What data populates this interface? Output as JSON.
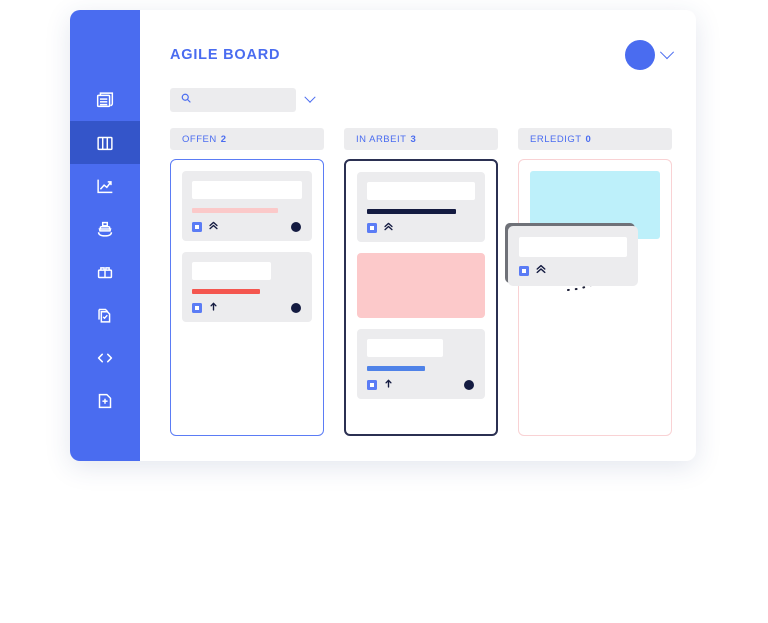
{
  "app": {
    "title": "AGILE BOARD"
  },
  "sidebar": {
    "items": [
      {
        "id": "reports",
        "icon": "stacked-document-icon",
        "active": false
      },
      {
        "id": "board",
        "icon": "columns-board-icon",
        "active": true
      },
      {
        "id": "analytics",
        "icon": "line-chart-icon",
        "active": false
      },
      {
        "id": "shipping",
        "icon": "ship-icon",
        "active": false
      },
      {
        "id": "toolbox",
        "icon": "toolbox-icon",
        "active": false
      },
      {
        "id": "tasks",
        "icon": "checked-pages-icon",
        "active": false
      },
      {
        "id": "code",
        "icon": "code-brackets-icon",
        "active": false
      },
      {
        "id": "new-file",
        "icon": "add-file-icon",
        "active": false
      }
    ]
  },
  "search": {
    "value": "",
    "placeholder": "",
    "icon": "search-icon",
    "dropdown_icon": "chevron-down-icon"
  },
  "profile": {
    "avatar": "user-avatar",
    "dropdown_icon": "chevron-down-icon"
  },
  "colors": {
    "brand_blue": "#4a6cf0",
    "sidebar_active": "#3455c9",
    "card_bg": "#ececee",
    "bar_pale_pink": "#fbc9c9",
    "bar_red": "#f4564f",
    "bar_navy": "#141b41",
    "bar_blue": "#4f82e8",
    "dropzone_pink": "#fcc9ca",
    "dropzone_cyan": "#bdf0fa",
    "border_blue": "#5b7cf5",
    "border_navy": "#2b3052",
    "border_pink": "#f9d2d4",
    "avatar_dot": "#141b41"
  },
  "board": {
    "columns": [
      {
        "id": "offen",
        "label": "OFFEN",
        "count": "2",
        "border_style": "blue",
        "cards": [
          {
            "bar": "pale-pink",
            "tag": "tag-icon",
            "priority": "priority-highest-icon",
            "avatar": true
          },
          {
            "bar": "red",
            "tag": "tag-icon",
            "priority": "priority-high-icon",
            "avatar": true
          }
        ]
      },
      {
        "id": "in-arbeit",
        "label": "IN ARBEIT",
        "count": "3",
        "border_style": "navy",
        "cards": [
          {
            "bar": "navy",
            "tag": "tag-icon",
            "priority": "priority-highest-icon",
            "avatar": false
          },
          {
            "dropzone": "pink"
          },
          {
            "bar": "blue",
            "tag": "tag-icon",
            "priority": "priority-high-icon",
            "avatar": true
          }
        ]
      },
      {
        "id": "erledigt",
        "label": "ERLEDIGT",
        "count": "0",
        "border_style": "pink",
        "cards": [
          {
            "dropzone": "cyan"
          }
        ]
      }
    ]
  },
  "drag": {
    "card": {
      "bar": "red",
      "tag": "tag-icon",
      "priority": "priority-highest-icon"
    },
    "trail": "dotted-drag-trail"
  }
}
